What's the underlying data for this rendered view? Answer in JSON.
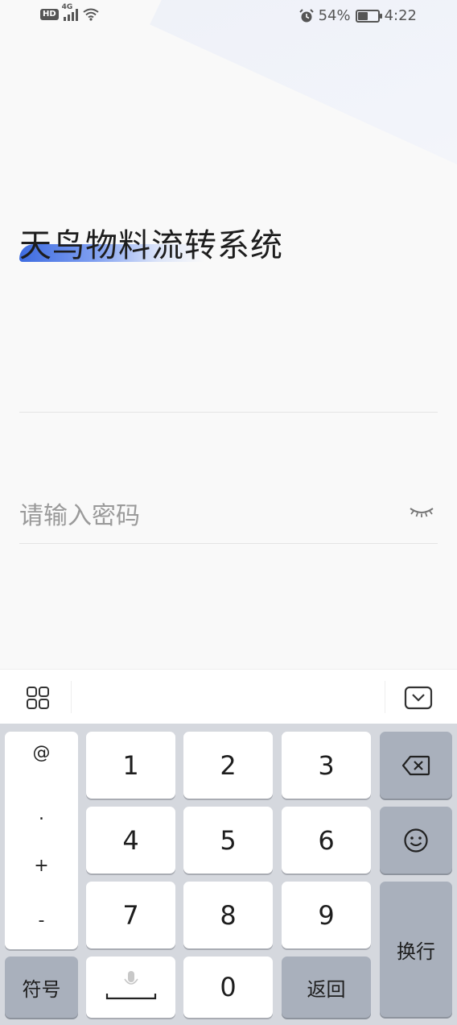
{
  "status_bar": {
    "hd": "HD",
    "network": "4G",
    "battery_text": "54%",
    "battery_level": 0.54,
    "time": "4:22",
    "icons": [
      "hd-icon",
      "signal-icon",
      "wifi-icon",
      "alarm-icon",
      "battery-icon"
    ]
  },
  "app": {
    "title": "天鸟物料流转系统",
    "accent_color": "#3d6be0"
  },
  "form": {
    "password_placeholder": "请输入密码",
    "password_value": ""
  },
  "keyboard": {
    "symbols": [
      "@",
      ".",
      "+",
      "-"
    ],
    "digits": [
      "1",
      "2",
      "3",
      "4",
      "5",
      "6",
      "7",
      "8",
      "9",
      "0"
    ],
    "symbol_key": "符号",
    "back_key": "返回",
    "enter_key": "换行"
  }
}
